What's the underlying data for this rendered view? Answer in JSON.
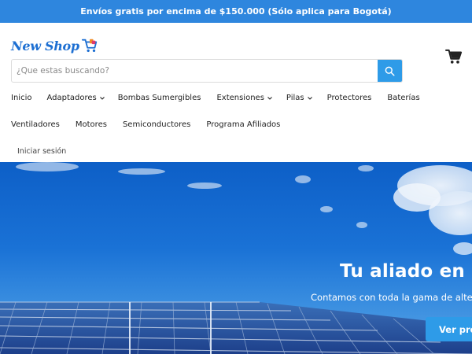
{
  "promo": {
    "text": "Envíos gratis por encima de $150.000 (Sólo aplica para Bogotá)"
  },
  "logo": {
    "text": "New Shop"
  },
  "search": {
    "placeholder": "¿Que estas buscando?"
  },
  "nav": {
    "row1": [
      {
        "label": "Inicio",
        "dropdown": false
      },
      {
        "label": "Adaptadores",
        "dropdown": true
      },
      {
        "label": "Bombas Sumergibles",
        "dropdown": false
      },
      {
        "label": "Extensiones",
        "dropdown": true
      },
      {
        "label": "Pilas",
        "dropdown": true
      },
      {
        "label": "Protectores",
        "dropdown": false
      },
      {
        "label": "Baterías",
        "dropdown": false
      }
    ],
    "row2": [
      {
        "label": "Ventiladores",
        "dropdown": false
      },
      {
        "label": "Motores",
        "dropdown": false
      },
      {
        "label": "Semiconductores",
        "dropdown": false
      },
      {
        "label": "Programa Afiliados",
        "dropdown": false
      }
    ]
  },
  "account": {
    "login_label": "Iniciar sesión"
  },
  "hero": {
    "title": "Tu aliado en",
    "subtitle": "Contamos con toda la gama de alte",
    "button_label": "Ver pro"
  },
  "colors": {
    "accent": "#2e86de",
    "button": "#2e9be8",
    "logo": "#1d6fd2"
  },
  "icons": {
    "search": "search-icon",
    "cart": "cart-icon",
    "chevron": "chevron-down-icon"
  }
}
